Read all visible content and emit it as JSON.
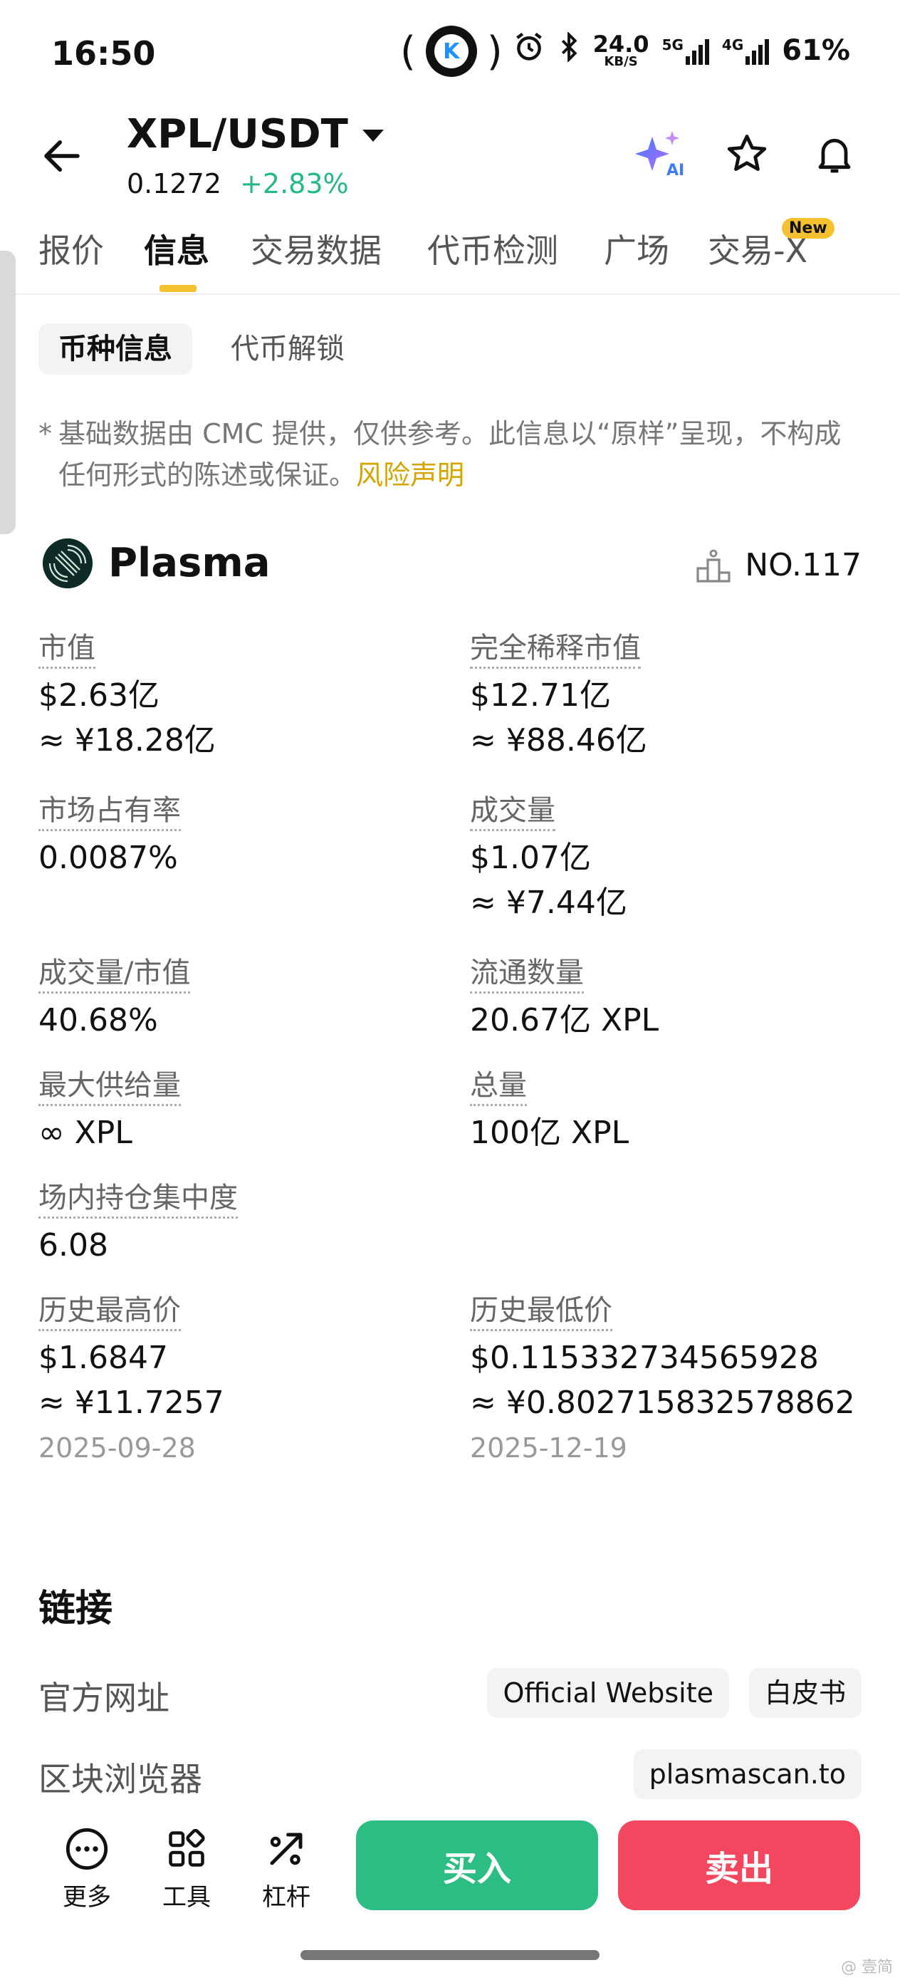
{
  "status_bar": {
    "time": "16:50",
    "center_badge": "K",
    "paren_left": "(",
    "paren_right": ")",
    "net_speed_value": "24.0",
    "net_speed_unit": "KB/S",
    "sig1_label": "5G",
    "sig2_label": "4G",
    "battery": "61%"
  },
  "header": {
    "pair": "XPL/USDT",
    "price": "0.1272",
    "change": "+2.83%",
    "ai_label": "AI"
  },
  "tabs": [
    "报价",
    "信息",
    "交易数据",
    "代币检测",
    "广场",
    "交易-X"
  ],
  "tab_new_badge": "New",
  "subtabs": [
    "币种信息",
    "代币解锁"
  ],
  "disclaimer": {
    "star": "*",
    "text": "基础数据由 CMC 提供，仅供参考。此信息以“原样”呈现，不构成任何形式的陈述或保证。",
    "risk_link": "风险声明"
  },
  "coin": {
    "name": "Plasma",
    "rank": "NO.117"
  },
  "stats": {
    "market_cap": {
      "label": "市值",
      "value": "$2.63亿",
      "sub": "≈ ¥18.28亿"
    },
    "fdv": {
      "label": "完全稀释市值",
      "value": "$12.71亿",
      "sub": "≈ ¥88.46亿"
    },
    "dominance": {
      "label": "市场占有率",
      "value": "0.0087%"
    },
    "volume": {
      "label": "成交量",
      "value": "$1.07亿",
      "sub": "≈ ¥7.44亿"
    },
    "vol_mcap": {
      "label": "成交量/市值",
      "value": "40.68%"
    },
    "circulating": {
      "label": "流通数量",
      "value": "20.67亿 XPL"
    },
    "max_supply": {
      "label": "最大供给量",
      "value": "∞ XPL"
    },
    "total": {
      "label": "总量",
      "value": "100亿 XPL"
    },
    "concentration": {
      "label": "场内持仓集中度",
      "value": "6.08"
    },
    "ath": {
      "label": "历史最高价",
      "value": "$1.6847",
      "sub": "≈ ¥11.7257",
      "date": "2025-09-28"
    },
    "atl": {
      "label": "历史最低价",
      "value": "$0.115332734565928",
      "sub": "≈ ¥0.802715832578862",
      "date": "2025-12-19"
    }
  },
  "links": {
    "title": "链接",
    "official_label": "官方网址",
    "official_btn": "Official Website",
    "whitepaper_btn": "白皮书",
    "explorer_label": "区块浏览器",
    "explorer_btn": "plasmascan.to"
  },
  "bottom": {
    "more": "更多",
    "tools": "工具",
    "leverage": "杠杆",
    "buy": "买入",
    "sell": "卖出",
    "watermark": "@ 壹简"
  },
  "colors": {
    "up": "#25b884",
    "buy": "#2bbd84",
    "sell": "#f4465f",
    "accent": "#f6c12e",
    "risk_link": "#d6a400"
  }
}
